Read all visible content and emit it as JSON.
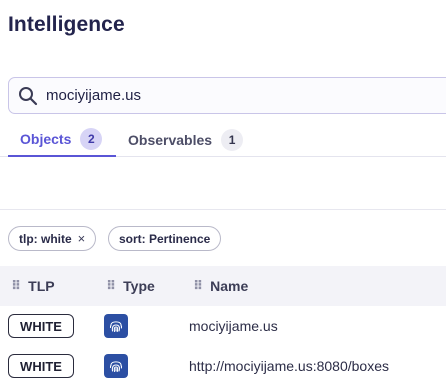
{
  "page": {
    "title": "Intelligence"
  },
  "search": {
    "value": "mociyijame.us",
    "icon": "search-icon"
  },
  "tabs": [
    {
      "label": "Objects",
      "count": "2",
      "active": true
    },
    {
      "label": "Observables",
      "count": "1",
      "active": false
    }
  ],
  "filters": {
    "tlp_chip": "tlp: white",
    "tlp_chip_close": "×",
    "sort_chip": "sort: Pertinence"
  },
  "table": {
    "columns": [
      {
        "label": "TLP"
      },
      {
        "label": "Type"
      },
      {
        "label": "Name"
      }
    ],
    "rows": [
      {
        "tlp": "WHITE",
        "type_icon": "fingerprint-icon",
        "name": "mociyijame.us"
      },
      {
        "tlp": "WHITE",
        "type_icon": "fingerprint-icon",
        "name": "http://mociyijame.us:8080/boxes"
      }
    ]
  },
  "colors": {
    "accent": "#5a55d6",
    "type_icon_bg": "#2c4fa3",
    "title": "#23244d"
  }
}
